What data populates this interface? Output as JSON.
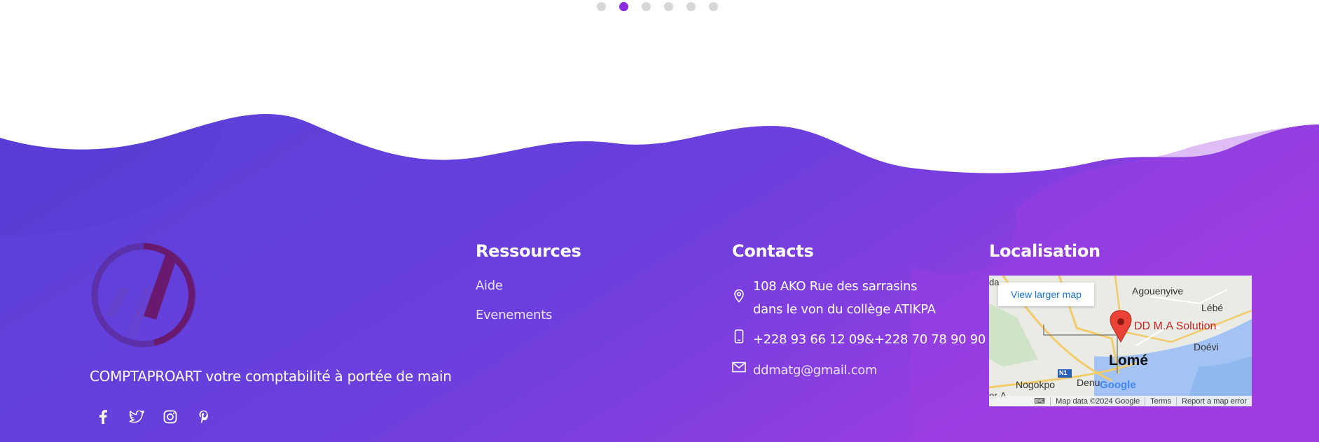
{
  "carousel": {
    "dots": 6,
    "active_index": 1
  },
  "footer": {
    "tagline": "COMPTAPROART votre comptabilité à portée de main",
    "social": [
      "facebook-icon",
      "twitter-icon",
      "instagram-icon",
      "pinterest-icon"
    ],
    "resources": {
      "title": "Ressources",
      "links": [
        "Aide",
        "Evenements"
      ]
    },
    "contacts": {
      "title": "Contacts",
      "address_line1": "108 AKO Rue des sarrasins",
      "address_line2": "dans le von du collège ATIKPA",
      "phone": "+228 93 66 12 09&+228 70 78 90 90",
      "email": "ddmatg@gmail.com"
    },
    "location": {
      "title": "Localisation",
      "map": {
        "view_larger": "View larger map",
        "place_name": "DD M.A Solution",
        "city": "Lomé",
        "labels": [
          "Agouenyive",
          "Lébé",
          "Doévi",
          "Nogokpo",
          "Denu",
          "N1",
          "da",
          "or-A"
        ],
        "attribution": "Map data ©2024 Google",
        "terms": "Terms",
        "report": "Report a map error",
        "google": "Google"
      }
    }
  },
  "colors": {
    "wave_start": "#5b3fd9",
    "wave_end": "#9b3fe0",
    "active_dot": "#8a2be2"
  }
}
